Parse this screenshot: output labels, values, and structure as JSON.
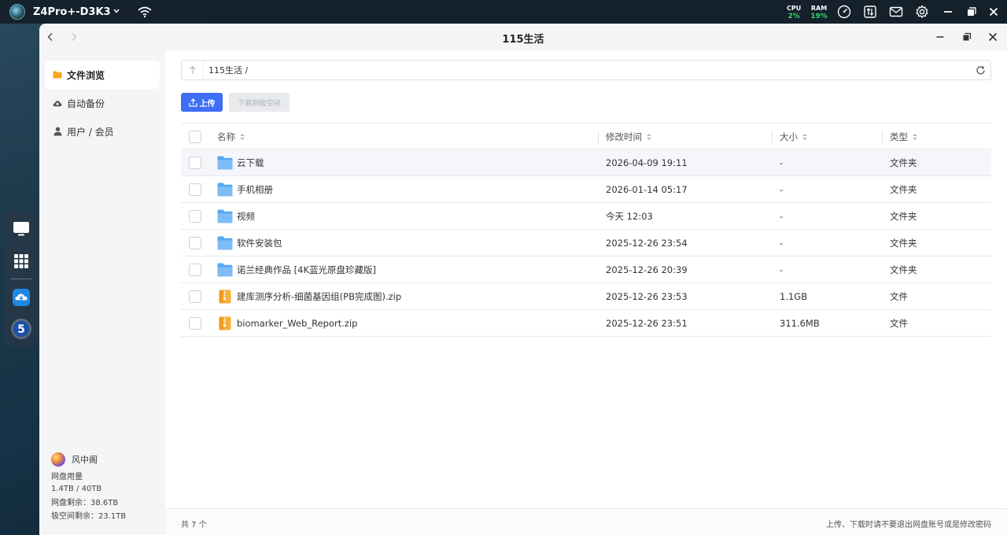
{
  "topbar": {
    "device_name": "Z4Pro+-D3K3",
    "cpu_label": "CPU",
    "cpu_value": "2%",
    "ram_label": "RAM",
    "ram_value": "19%",
    "stat_value_color": "#35d56a"
  },
  "window": {
    "title": "115生活"
  },
  "sidebar": {
    "items": [
      {
        "label": "文件浏览",
        "icon": "folder-icon",
        "active": true
      },
      {
        "label": "自动备份",
        "icon": "cloud-backup-icon",
        "active": false
      },
      {
        "label": "用户 / 会员",
        "icon": "user-icon",
        "active": false
      }
    ],
    "user": {
      "name": "风中阁",
      "quota_title": "网盘用量",
      "quota_used": "1.4TB / 40TB",
      "quota_remaining": "网盘剩余：38.6TB",
      "space_remaining": "极空间剩余：23.1TB"
    }
  },
  "main": {
    "path": "115生活 /",
    "upload_label": "上传",
    "download_label": "下载到极空间",
    "accent_color": "#3d6ef5",
    "columns": [
      "名称",
      "修改时间",
      "大小",
      "类型"
    ],
    "rows": [
      {
        "name": "云下载",
        "time": "2026-04-09 19:11",
        "size": "-",
        "type": "文件夹",
        "kind": "folder"
      },
      {
        "name": "手机相册",
        "time": "2026-01-14 05:17",
        "size": "-",
        "type": "文件夹",
        "kind": "folder"
      },
      {
        "name": "视频",
        "time": "今天 12:03",
        "size": "-",
        "type": "文件夹",
        "kind": "folder"
      },
      {
        "name": "软件安装包",
        "time": "2025-12-26 23:54",
        "size": "-",
        "type": "文件夹",
        "kind": "folder"
      },
      {
        "name": "诺兰经典作品 [4K蓝光原盘珍藏版]",
        "time": "2025-12-26 20:39",
        "size": "-",
        "type": "文件夹",
        "kind": "folder"
      },
      {
        "name": "建库测序分析-细菌基因组(PB完成图).zip",
        "time": "2025-12-26 23:53",
        "size": "1.1GB",
        "type": "文件",
        "kind": "zip"
      },
      {
        "name": "biomarker_Web_Report.zip",
        "time": "2025-12-26 23:51",
        "size": "311.6MB",
        "type": "文件",
        "kind": "zip"
      }
    ],
    "footer_count": "共 7 个",
    "footer_tip": "上传、下载时请不要退出网盘账号或是修改密码"
  }
}
